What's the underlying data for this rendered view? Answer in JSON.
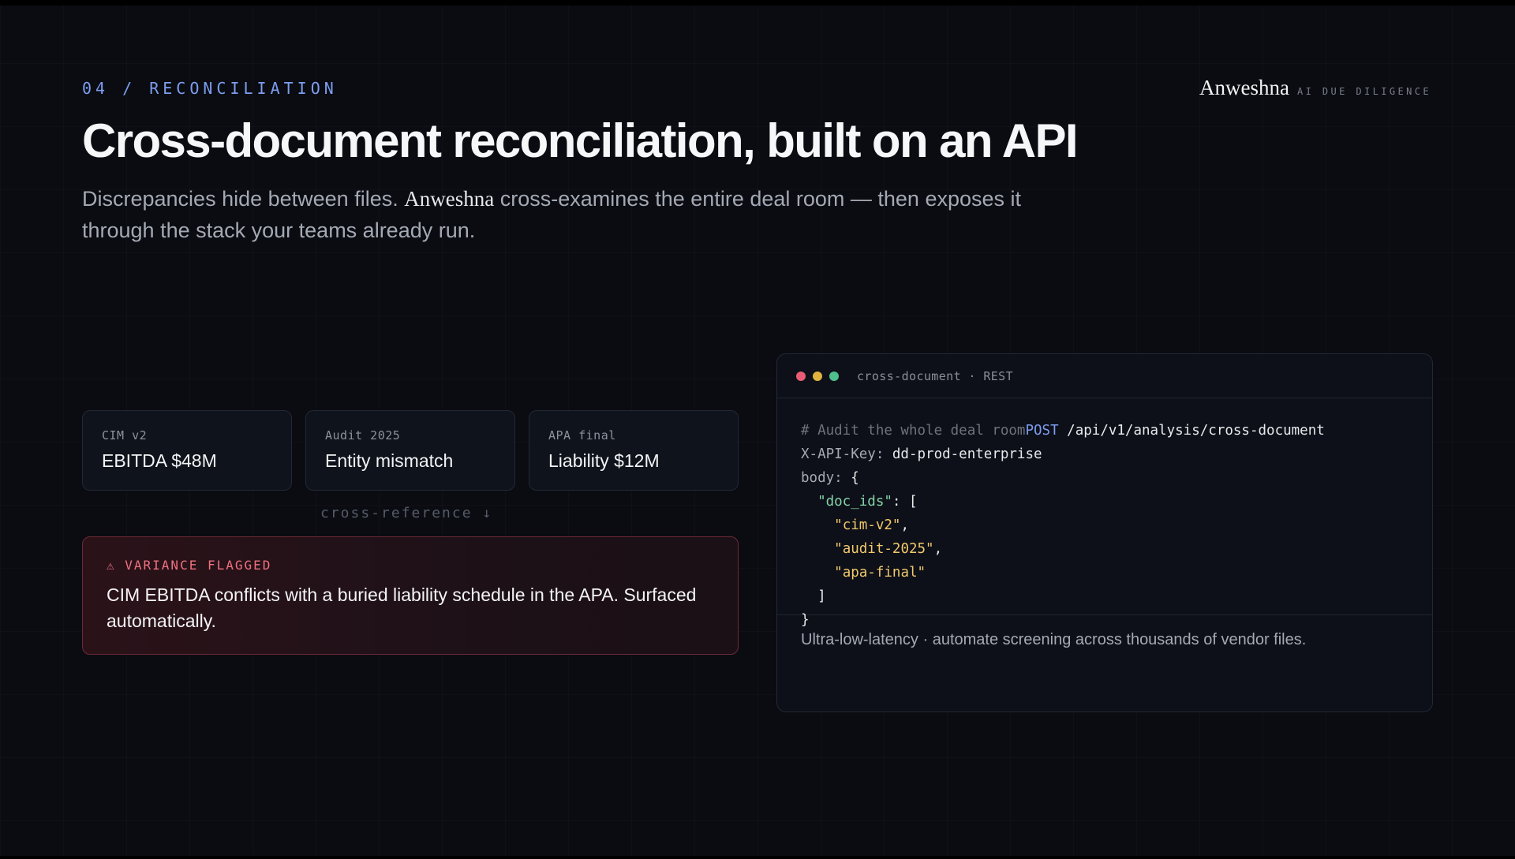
{
  "eyebrow": "04 / RECONCILIATION",
  "brand": {
    "name": "Anweshna",
    "tagline": "AI DUE DILIGENCE"
  },
  "title": "Cross-document reconciliation, built on an API",
  "subtitle": {
    "part1": "Discrepancies hide between files. ",
    "brand": "Anweshna",
    "part2": " cross-examines the entire deal room — then exposes it through the stack your teams already run."
  },
  "documents": [
    {
      "label": "CIM v2",
      "value": "EBITDA $48M"
    },
    {
      "label": "Audit 2025",
      "value": "Entity mismatch"
    },
    {
      "label": "APA final",
      "value": "Liability $12M"
    }
  ],
  "cross_reference": "cross-reference ↓",
  "alert": {
    "label": "⚠ VARIANCE FLAGGED",
    "text": "CIM EBITDA conflicts with a buried liability schedule in the APA. Surfaced automatically."
  },
  "api_panel": {
    "title": "cross-document · REST",
    "code": {
      "comment": "# Audit the whole deal room",
      "method": "POST",
      "path": " /api/v1/analysis/cross-document",
      "header_key": "X-API-Key:",
      "header_value": " dd-prod-enterprise",
      "body_key": "body:",
      "body_open": " {",
      "prop": "\"doc_ids\"",
      "prop_tail": ": [",
      "ids": [
        "\"cim-v2\"",
        "\"audit-2025\"",
        "\"apa-final\""
      ],
      "comma": ",",
      "array_close": "]",
      "body_close": "}"
    },
    "footer": "Ultra-low-latency · automate screening across thousands of vendor files."
  },
  "colors": {
    "accent": "#7d9ef0",
    "alert": "#f0727f",
    "dot_red": "#e85d75",
    "dot_yellow": "#e0b341",
    "dot_green": "#4fc08d"
  }
}
